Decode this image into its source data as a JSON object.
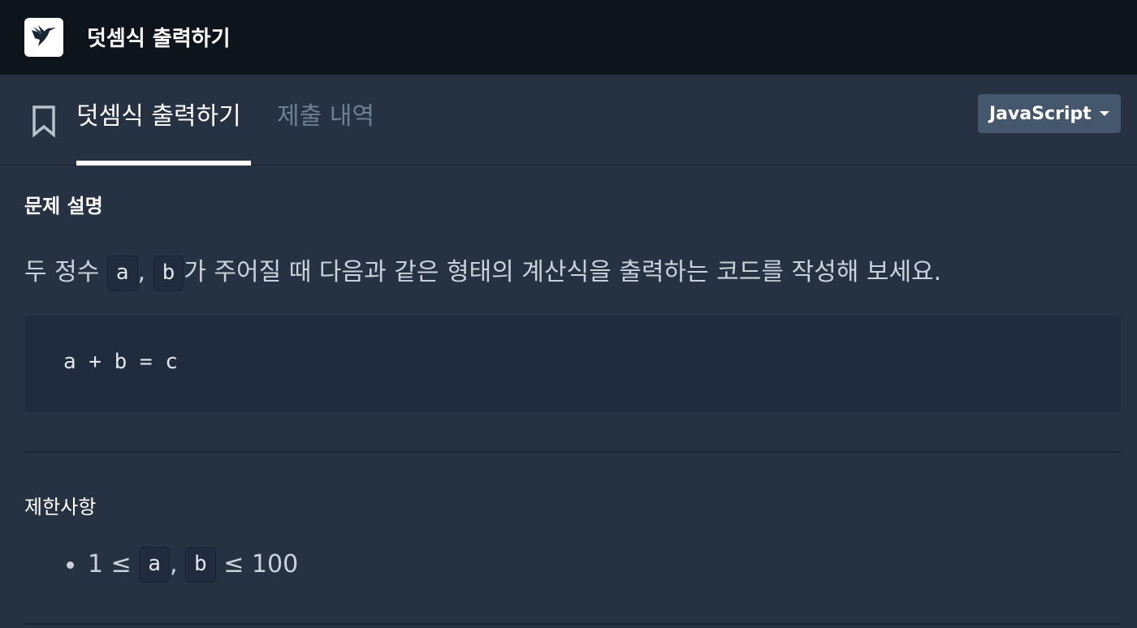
{
  "header": {
    "logo_icon": "hummingbird-icon",
    "title": "덧셈식 출력하기"
  },
  "tabs": [
    {
      "label": "덧셈식 출력하기",
      "active": true
    },
    {
      "label": "제출 내역",
      "active": false
    }
  ],
  "language_select": {
    "selected": "JavaScript"
  },
  "problem": {
    "section_title": "문제 설명",
    "desc_prefix": "두 정수 ",
    "var_a": "a",
    "comma": ",",
    "var_b": "b",
    "desc_suffix": "가 주어질 때 다음과 같은 형태의 계산식을 출력하는 코드를 작성해 보세요.",
    "code_example": "a + b = c"
  },
  "constraints": {
    "section_title": "제한사항",
    "prefix": "1 ≤ ",
    "var_a": "a",
    "comma": ",",
    "var_b": "b",
    "suffix": " ≤ 100"
  },
  "colors": {
    "topbar_bg": "#0e141b",
    "page_bg": "#263142",
    "code_bg": "#202b3d",
    "select_bg": "#44576c"
  }
}
